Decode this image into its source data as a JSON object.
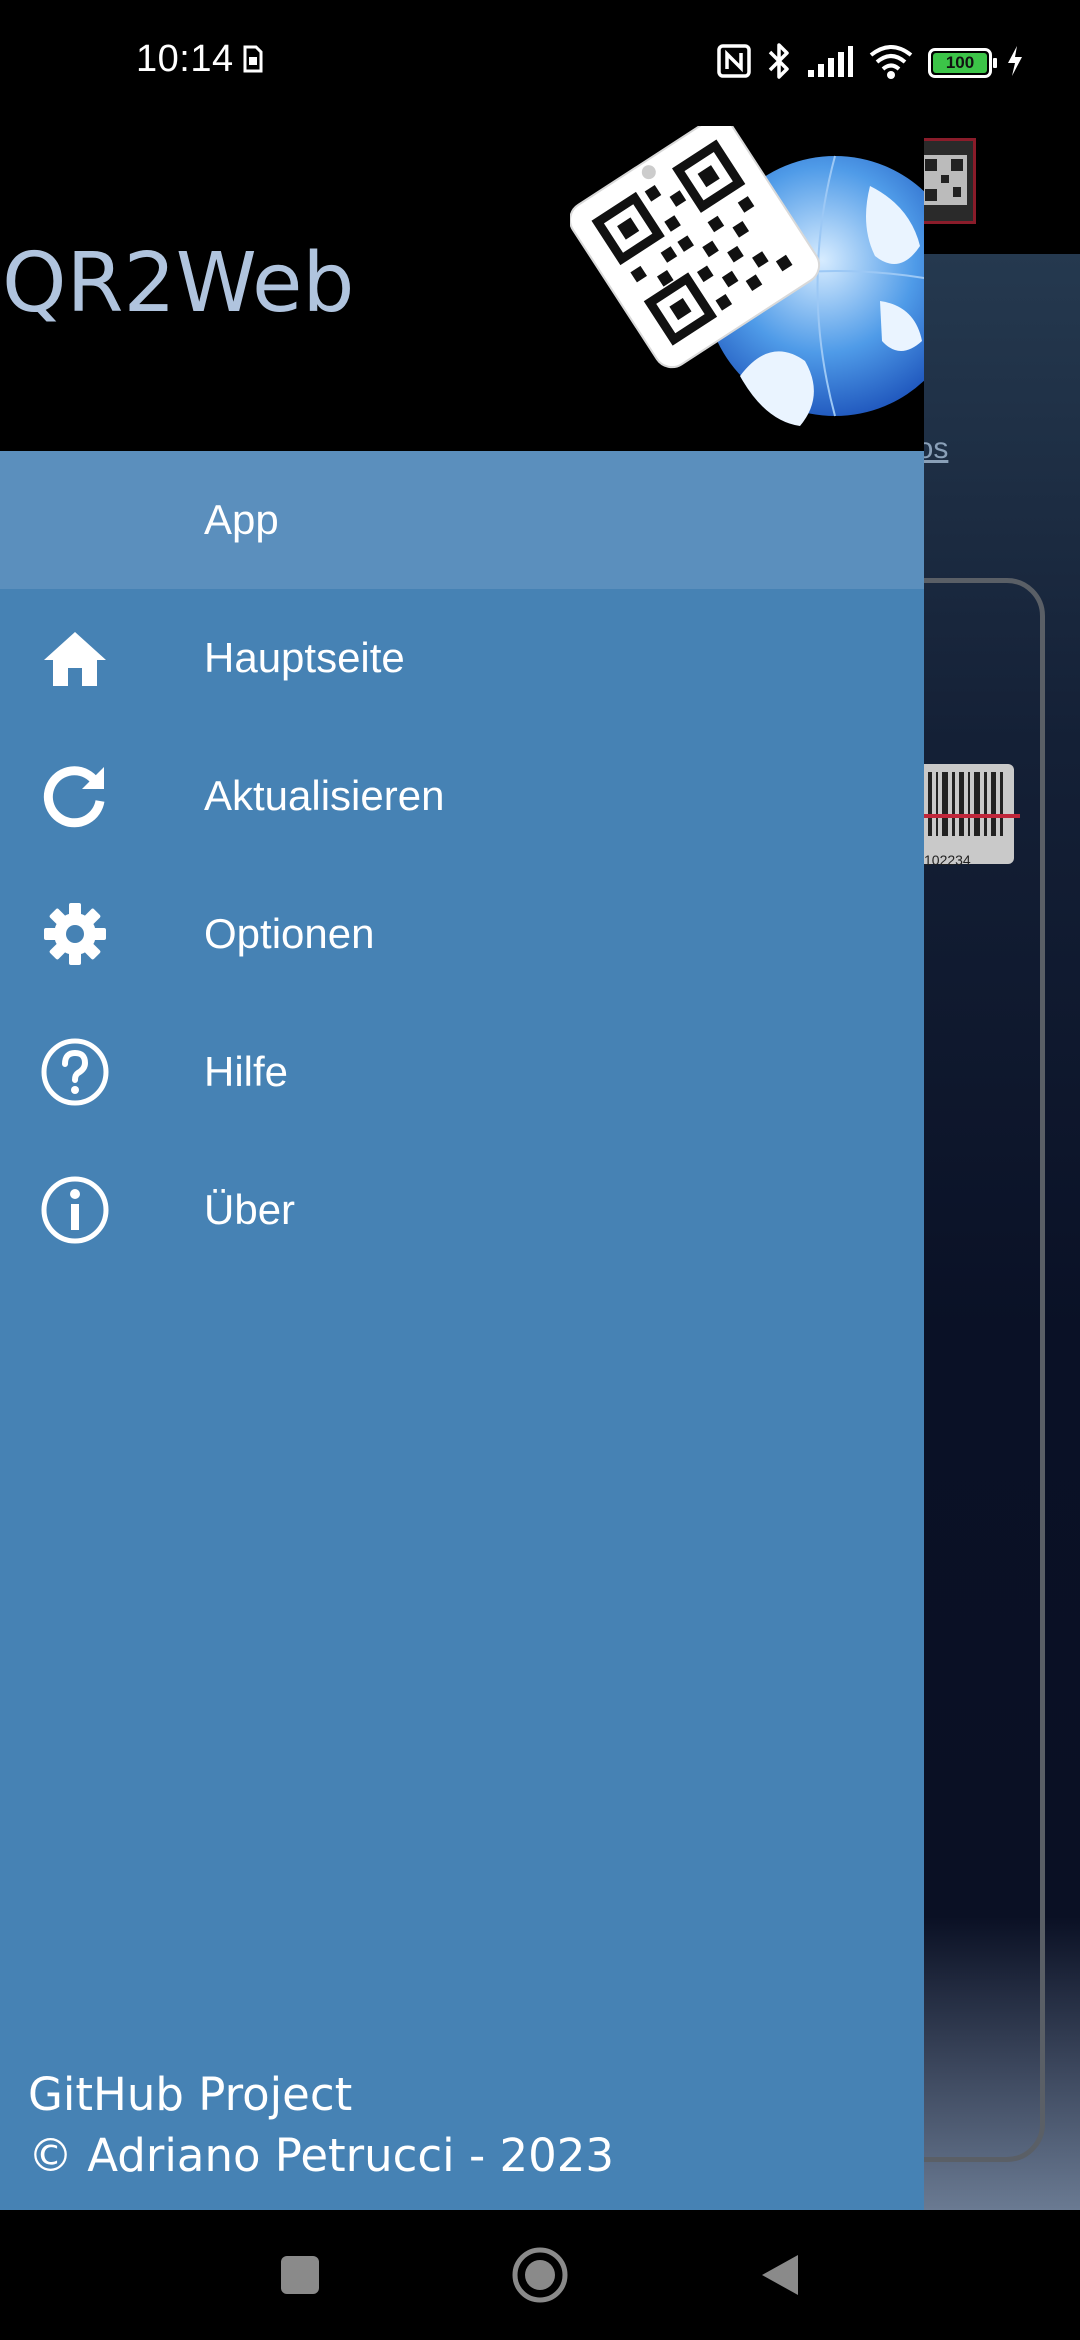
{
  "status_bar": {
    "time": "10:14",
    "battery_level": "100",
    "icons": [
      "sim-icon",
      "nfc-icon",
      "bluetooth-icon",
      "signal-icon",
      "wifi-icon",
      "battery-icon",
      "charging-icon"
    ]
  },
  "background_app": {
    "link_text": "nos",
    "barcode_number": "102234"
  },
  "drawer": {
    "title": "QR2Web",
    "menu": [
      {
        "label": "App",
        "icon": "none",
        "active": true
      },
      {
        "label": "Hauptseite",
        "icon": "home-icon"
      },
      {
        "label": "Aktualisieren",
        "icon": "refresh-icon"
      },
      {
        "label": "Optionen",
        "icon": "gear-icon"
      },
      {
        "label": "Hilfe",
        "icon": "help-circle-icon"
      },
      {
        "label": "Über",
        "icon": "info-circle-icon"
      }
    ],
    "footer": {
      "project_link": "GitHub Project",
      "copyright": "© Adriano Petrucci - 2023"
    }
  },
  "nav_bar": {
    "buttons": [
      "recents-button",
      "home-button",
      "back-button"
    ]
  },
  "colors": {
    "drawer_bg": "#4682b4",
    "active_item_bg": "#5b8fbd",
    "title_color": "#b0c4de",
    "header_bg": "#000000"
  }
}
